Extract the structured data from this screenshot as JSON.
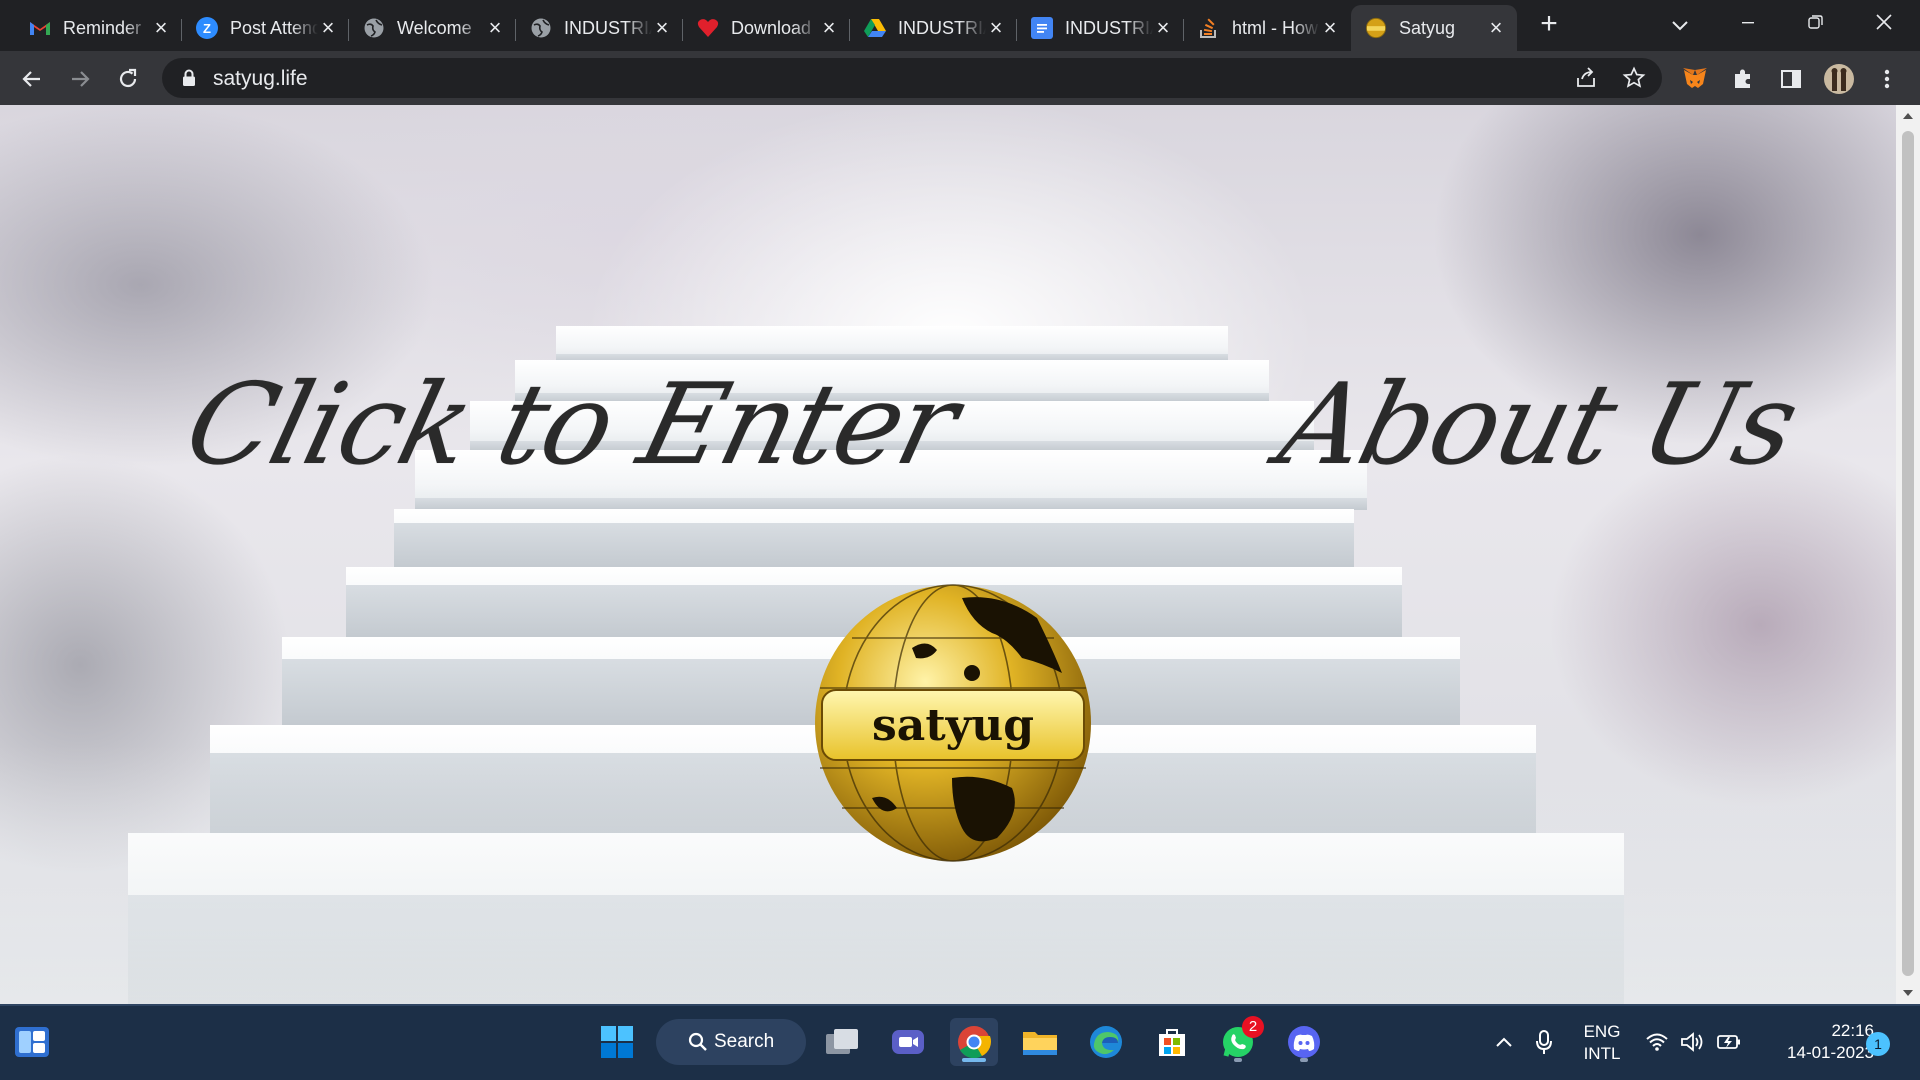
{
  "browser": {
    "tabs": [
      {
        "title": "Reminder",
        "favicon": "gmail-icon"
      },
      {
        "title": "Post Attendance",
        "favicon": "zoom-icon"
      },
      {
        "title": "Welcome",
        "favicon": "globe-icon"
      },
      {
        "title": "INDUSTRIAL",
        "favicon": "globe-icon"
      },
      {
        "title": "Download",
        "favicon": "heart-icon"
      },
      {
        "title": "INDUSTRIAL",
        "favicon": "google-drive-icon"
      },
      {
        "title": "INDUSTRIAL",
        "favicon": "google-docs-icon"
      },
      {
        "title": "html - How",
        "favicon": "stackoverflow-icon"
      },
      {
        "title": "Satyug",
        "favicon": "satyug-globe-icon"
      }
    ],
    "active_tab": "Satyug",
    "url": "satyug.life"
  },
  "page": {
    "enter_link": "Click to Enter",
    "about_link": "About Us",
    "logo_text": "satyug"
  },
  "taskbar": {
    "search_label": "Search",
    "lang_line1": "ENG",
    "lang_line2": "INTL",
    "time": "22:16",
    "date": "14-01-2023",
    "whatsapp_badge": "2",
    "notification_count": "1"
  },
  "colors": {
    "accent": "#1a73e8",
    "taskbar": "#1c2f47",
    "gold": "#d4a017"
  }
}
